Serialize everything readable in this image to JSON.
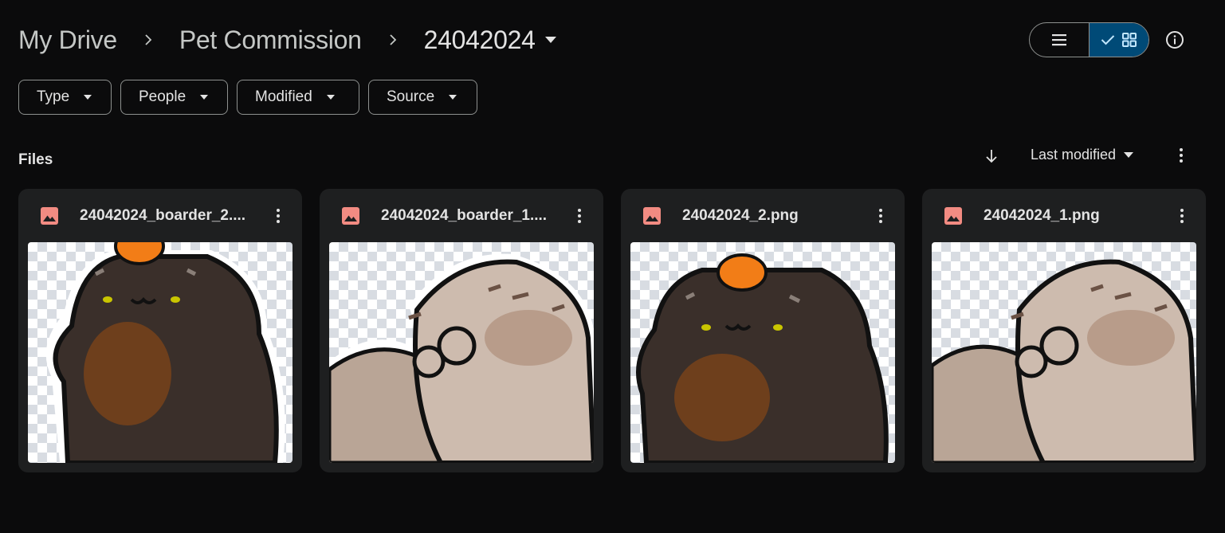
{
  "breadcrumb": {
    "root": "My Drive",
    "parent": "Pet Commission",
    "current": "24042024"
  },
  "view": {
    "list_icon": "list-icon",
    "grid_icon": "grid-icon",
    "selected": "grid"
  },
  "filters": [
    {
      "label": "Type"
    },
    {
      "label": "People"
    },
    {
      "label": "Modified"
    },
    {
      "label": "Source"
    }
  ],
  "section": {
    "title": "Files",
    "sort_field": "Last modified",
    "sort_direction": "descending"
  },
  "files": [
    {
      "name": "24042024_boarder_2....",
      "icon": "image-file-icon",
      "subject": "dark-cat-with-pumpkin"
    },
    {
      "name": "24042024_boarder_1....",
      "icon": "image-file-icon",
      "subject": "tabby-cat-paws"
    },
    {
      "name": "24042024_2.png",
      "icon": "image-file-icon",
      "subject": "dark-cat-with-pumpkin"
    },
    {
      "name": "24042024_1.png",
      "icon": "image-file-icon",
      "subject": "tabby-cat-paws"
    }
  ],
  "colors": {
    "background": "#0b0b0c",
    "card": "#1e1f20",
    "selected_toggle": "#004a77",
    "image_icon": "#f28b82"
  }
}
